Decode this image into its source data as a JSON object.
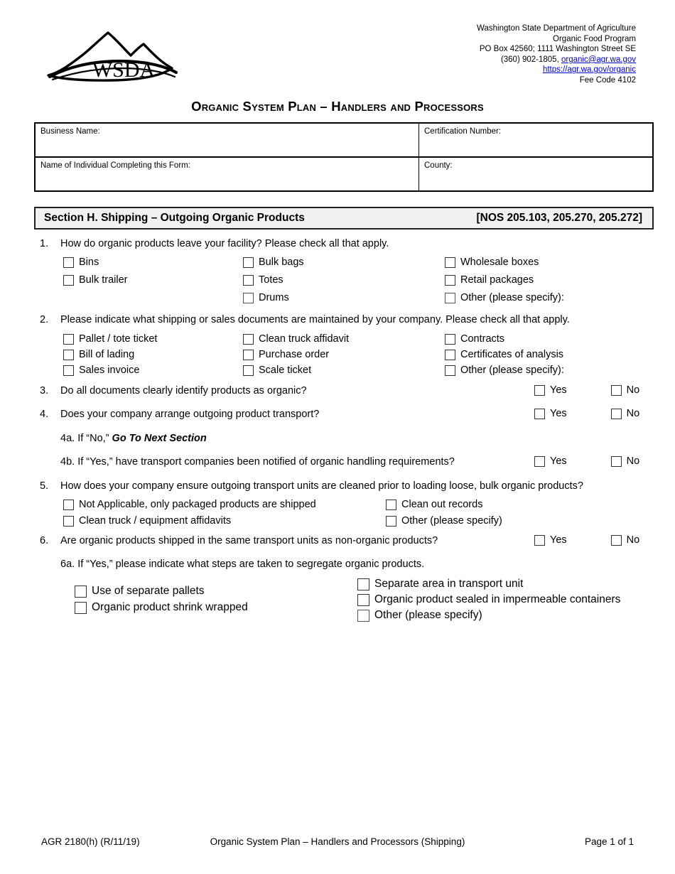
{
  "header": {
    "logo_text": "WSDA",
    "agency_lines": [
      {
        "text": "Washington State Department of Agriculture",
        "link": false
      },
      {
        "text": "Organic Food Program",
        "link": false
      },
      {
        "text": "PO Box 42560; 1111 Washington Street SE",
        "link": false
      }
    ],
    "phone_prefix": "(360) 902-1805, ",
    "email": "organic@agr.wa.gov",
    "website": "https://agr.wa.gov/organic",
    "fee_code": "Fee Code 4102",
    "link_color": "#0000cc"
  },
  "title": "Organic System Plan – Handlers and Processors",
  "info_table": {
    "business_name_label": "Business Name:",
    "certification_number_label": "Certification Number:",
    "individual_name_label": "Name of Individual Completing this Form:",
    "county_label": "County:"
  },
  "section": {
    "title": "Section H.  Shipping – Outgoing Organic Products",
    "reference": "[NOS 205.103, 205.270, 205.272]"
  },
  "questions": {
    "q1": {
      "number": "1.",
      "text": "How do organic products leave your facility? Please check all that apply.",
      "col1": [
        "Bins",
        "Bulk trailer"
      ],
      "col2": [
        "Bulk bags",
        "Totes",
        "Drums"
      ],
      "col3": [
        "Wholesale boxes",
        "Retail packages",
        "Other (please specify):"
      ]
    },
    "q2": {
      "number": "2.",
      "text": "Please indicate what shipping or sales documents are maintained by your company. Please check all that apply.",
      "col1": [
        "Pallet / tote ticket",
        "Bill of lading",
        "Sales invoice"
      ],
      "col2": [
        "Clean truck affidavit",
        "Purchase order",
        "Scale ticket"
      ],
      "col3": [
        "Contracts",
        "Certificates of analysis",
        "Other (please specify):"
      ]
    },
    "q3": {
      "number": "3.",
      "text": "Do all documents clearly identify products as organic?",
      "yes": "Yes",
      "no": "No"
    },
    "q4": {
      "number": "4.",
      "text": "Does your company arrange outgoing product transport?",
      "yes": "Yes",
      "no": "No"
    },
    "q4a": {
      "label": "4a.",
      "text_before": "If “No,” ",
      "emphasis": "Go To Next Section"
    },
    "q4b": {
      "label": "4b.",
      "text": "If “Yes,” have transport companies been notified of organic handling requirements?",
      "yes": "Yes",
      "no": "No"
    },
    "q5": {
      "number": "5.",
      "text": "How does your company ensure outgoing transport units are cleaned prior to loading loose, bulk organic products?",
      "col1": [
        "Not Applicable, only packaged products are shipped",
        "Clean truck / equipment affidavits"
      ],
      "col2": [
        "Clean out records",
        "Other (please specify)"
      ]
    },
    "q6": {
      "number": "6.",
      "text": "Are organic products shipped in the same transport units as non-organic products?",
      "yes": "Yes",
      "no": "No"
    },
    "q6a": {
      "label": "6a.",
      "text": "If “Yes,” please indicate what steps are taken to segregate organic products.",
      "col1": [
        "Use of separate pallets",
        "Organic product shrink wrapped"
      ],
      "col2": [
        "Separate area in transport unit",
        "Organic product sealed in impermeable containers",
        "Other (please specify)"
      ]
    }
  },
  "footer": {
    "form_code": "AGR 2180(h) (R/11/19)",
    "center": "Organic System Plan – Handlers and Processors (Shipping)",
    "page": "Page 1 of 1"
  }
}
